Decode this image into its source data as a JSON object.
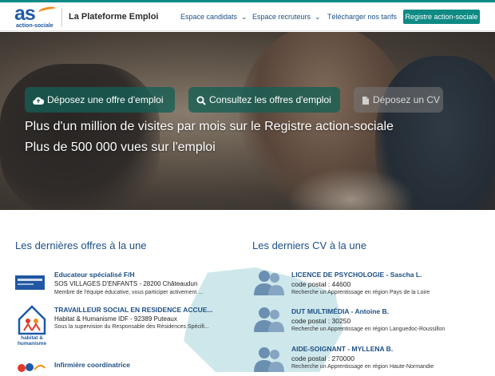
{
  "header": {
    "logo_text": "as",
    "logo_sub": "action-sociale",
    "brand": "La Plateforme Emploi",
    "nav": [
      {
        "label": "Espace candidats"
      },
      {
        "label": "Espace recruteurs"
      },
      {
        "label": "Télécharger nos tarifs"
      }
    ],
    "cta": "Registre action-sociale"
  },
  "hero": {
    "buttons": [
      {
        "label": "Déposez une offre d'emploi",
        "icon": "cloud-upload-icon"
      },
      {
        "label": "Consultez les offres d'emploi",
        "icon": "search-icon"
      },
      {
        "label": "Déposez un CV",
        "icon": "file-icon"
      }
    ],
    "line1": "Plus d'un million de visites par mois sur le Registre action-sociale",
    "line2": "Plus de 500 000 vues sur l'emploi"
  },
  "offers": {
    "title": "Les dernières offres à la une",
    "items": [
      {
        "title": "Educateur spécialisé F/H",
        "employer": "SOS VILLAGES D'ENFANTS - 28200 Châteaudun",
        "desc": "Membre de l'équipe éducative, vous participer activement ..."
      },
      {
        "title": "TRAVAILLEUR SOCIAL EN RESIDENCE ACCUE...",
        "employer": "Habitat & Humanisme IDF - 92389 Puteaux",
        "desc": "Sous la supervision du Responsable des Résidences Spécifi...",
        "logo_text": "habitat & humanisme"
      },
      {
        "title": "Infirmière coordinatrice"
      }
    ]
  },
  "cvs": {
    "title": "Les derniers CV à la une",
    "items": [
      {
        "title": "LICENCE DE PSYCHOLOGIE - Sascha L.",
        "postal": "code postal : 44600",
        "desc": "Recherche un Apprentissage en région Pays de la Loire"
      },
      {
        "title": "DUT MULTIMÉDIA - Antoine B.",
        "postal": "code postal : 30250",
        "desc": "Recherche un Apprentissage en région Languedoc-Roussillon"
      },
      {
        "title": "AIDE-SOIGNANT - MYLLENA B.",
        "postal": "code postal : 270000",
        "desc": "Recherche un Apprentissage en région Haute-Normandie"
      }
    ]
  },
  "colors": {
    "accent": "#0f8a85",
    "link": "#1c4f86",
    "brand_orange": "#f28c1a"
  }
}
